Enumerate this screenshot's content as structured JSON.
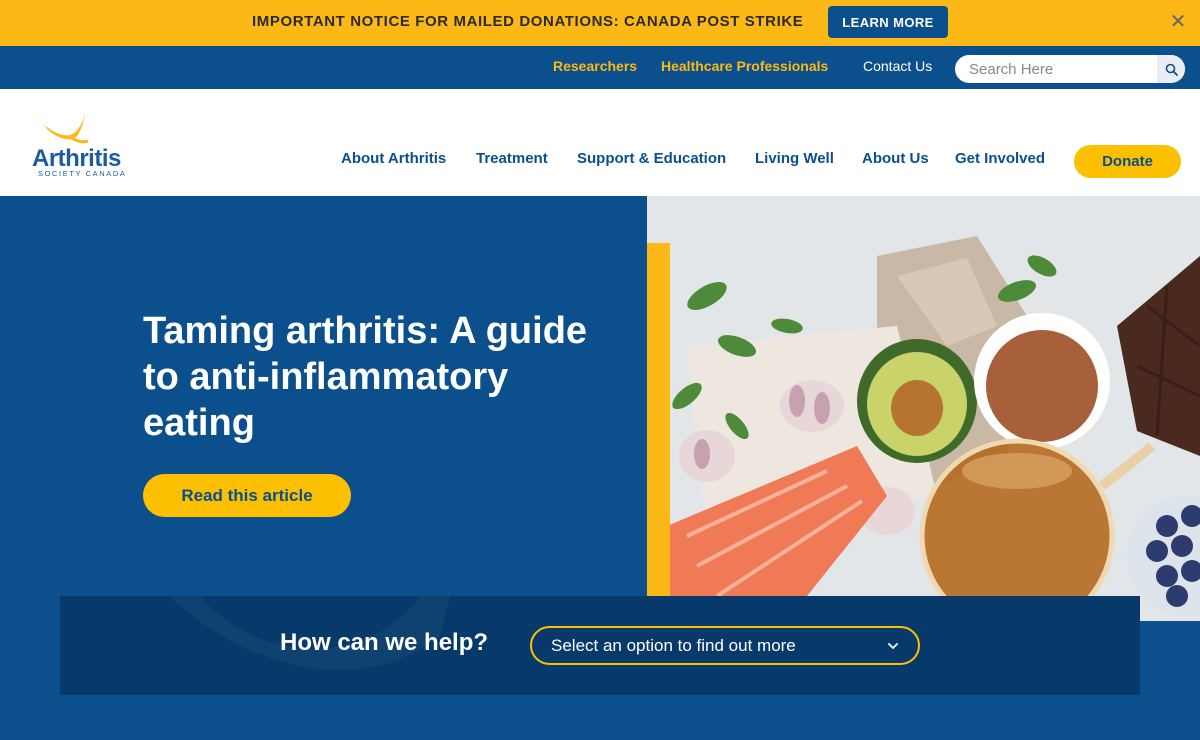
{
  "notice": {
    "text": "IMPORTANT NOTICE FOR MAILED DONATIONS: CANADA POST STRIKE",
    "button_label": "LEARN MORE",
    "close_symbol": "✕"
  },
  "utility_nav": {
    "links": [
      "Researchers",
      "Healthcare Professionals",
      "Contact Us"
    ],
    "search_placeholder": "Search Here",
    "search_icon": "search-icon"
  },
  "logo": {
    "word": "Arthritis",
    "sub": "SOCIETY CANADA"
  },
  "main_nav": {
    "items": [
      "About Arthritis",
      "Treatment",
      "Support & Education",
      "Living Well",
      "About Us",
      "Get Involved"
    ],
    "donate_label": "Donate"
  },
  "hero": {
    "title": "Taming arthritis: A guide to anti-inflammatory eating",
    "cta_label": "Read this article"
  },
  "help": {
    "label": "How can we help?",
    "select_value": "Select an option to find out more",
    "chevron_icon": "chevron-down-icon"
  },
  "colors": {
    "brand_blue": "#0b4f8c",
    "dark_blue": "#073a6a",
    "accent_yellow": "#fbb817"
  }
}
